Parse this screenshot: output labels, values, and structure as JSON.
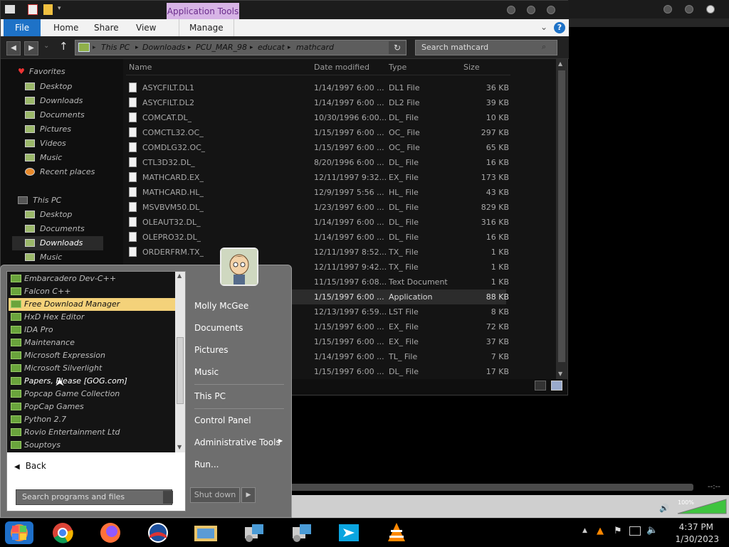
{
  "explorer": {
    "contextual_tab": "Application Tools",
    "ribbon_tabs": [
      "File",
      "Home",
      "Share",
      "View",
      "Manage"
    ],
    "breadcrumbs": [
      "This PC",
      "Downloads",
      "PCU_MAR_98",
      "educat",
      "mathcard"
    ],
    "search_placeholder": "Search mathcard",
    "nav": {
      "favorites_header": "Favorites",
      "favorites": [
        "Desktop",
        "Downloads",
        "Documents",
        "Pictures",
        "Videos",
        "Music",
        "Recent places"
      ],
      "thispc_header": "This PC",
      "thispc": [
        "Desktop",
        "Documents",
        "Downloads",
        "Music"
      ]
    },
    "columns": {
      "name": "Name",
      "date": "Date modified",
      "type": "Type",
      "size": "Size"
    },
    "files": [
      {
        "name": "ASYCFILT.DL1",
        "date": "1/14/1997 6:00 ...",
        "type": "DL1 File",
        "size": "36 KB"
      },
      {
        "name": "ASYCFILT.DL2",
        "date": "1/14/1997 6:00 ...",
        "type": "DL2 File",
        "size": "39 KB"
      },
      {
        "name": "COMCAT.DL_",
        "date": "10/30/1996 6:00...",
        "type": "DL_ File",
        "size": "10 KB"
      },
      {
        "name": "COMCTL32.OC_",
        "date": "1/15/1997 6:00 ...",
        "type": "OC_ File",
        "size": "297 KB"
      },
      {
        "name": "COMDLG32.OC_",
        "date": "1/15/1997 6:00 ...",
        "type": "OC_ File",
        "size": "65 KB"
      },
      {
        "name": "CTL3D32.DL_",
        "date": "8/20/1996 6:00 ...",
        "type": "DL_ File",
        "size": "16 KB"
      },
      {
        "name": "MATHCARD.EX_",
        "date": "12/11/1997 9:32...",
        "type": "EX_ File",
        "size": "173 KB"
      },
      {
        "name": "MATHCARD.HL_",
        "date": "12/9/1997 5:56 ...",
        "type": "HL_ File",
        "size": "43 KB"
      },
      {
        "name": "MSVBVM50.DL_",
        "date": "1/23/1997 6:00 ...",
        "type": "DL_ File",
        "size": "829 KB"
      },
      {
        "name": "OLEAUT32.DL_",
        "date": "1/14/1997 6:00 ...",
        "type": "DL_ File",
        "size": "316 KB"
      },
      {
        "name": "OLEPRO32.DL_",
        "date": "1/14/1997 6:00 ...",
        "type": "DL_ File",
        "size": "16 KB"
      },
      {
        "name": "ORDERFRM.TX_",
        "date": "12/11/1997 8:52...",
        "type": "TX_ File",
        "size": "1 KB"
      },
      {
        "name": "",
        "date": "12/11/1997 9:42...",
        "type": "TX_ File",
        "size": "1 KB"
      },
      {
        "name": "",
        "date": "11/15/1997 6:08...",
        "type": "Text Document",
        "size": "1 KB"
      },
      {
        "name": "",
        "date": "1/15/1997 6:00 ...",
        "type": "Application",
        "size": "88 KB",
        "selected": true
      },
      {
        "name": "",
        "date": "12/13/1997 6:59...",
        "type": "LST File",
        "size": "8 KB"
      },
      {
        "name": "",
        "date": "1/15/1997 6:00 ...",
        "type": "EX_ File",
        "size": "72 KB"
      },
      {
        "name": "",
        "date": "1/15/1997 6:00 ...",
        "type": "EX_ File",
        "size": "37 KB"
      },
      {
        "name": "",
        "date": "1/14/1997 6:00 ...",
        "type": "TL_ File",
        "size": "7 KB"
      },
      {
        "name": "",
        "date": "1/15/1997 6:00 ...",
        "type": "DL_ File",
        "size": "17 KB"
      }
    ]
  },
  "startmenu": {
    "programs": [
      {
        "label": "Embarcadero Dev-C++"
      },
      {
        "label": "Falcon C++"
      },
      {
        "label": "Free Download Manager",
        "highlighted": true
      },
      {
        "label": "HxD Hex Editor"
      },
      {
        "label": "IDA Pro"
      },
      {
        "label": "Maintenance"
      },
      {
        "label": "Microsoft Expression"
      },
      {
        "label": "Microsoft Silverlight"
      },
      {
        "label": "Papers, Please [GOG.com]",
        "hover": true
      },
      {
        "label": "Popcap Game Collection"
      },
      {
        "label": "PopCap Games"
      },
      {
        "label": "Python 2.7"
      },
      {
        "label": "Rovio Entertainment Ltd"
      },
      {
        "label": "Souptoys"
      }
    ],
    "back_label": "Back",
    "search_placeholder": "Search programs and files",
    "right_links": [
      "Molly McGee",
      "Documents",
      "Pictures",
      "Music",
      "This PC",
      "Control Panel",
      "Administrative Tools",
      "Run..."
    ],
    "shutdown_label": "Shut down"
  },
  "media": {
    "time_display": "--:--",
    "volume_label": "100%"
  },
  "taskbar": {
    "apps": [
      "windows-start",
      "chrome",
      "firefox",
      "obama-app",
      "file-explorer",
      "installer-1",
      "installer-2",
      "share-app",
      "vlc"
    ],
    "clock_time": "4:37 PM",
    "clock_date": "1/30/2023"
  }
}
